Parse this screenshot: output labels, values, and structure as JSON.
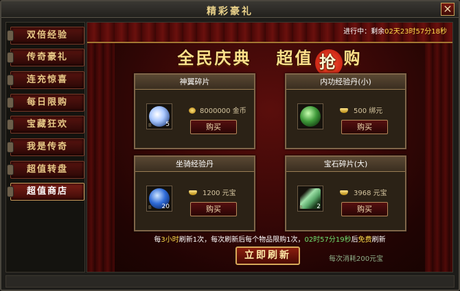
{
  "window": {
    "title": "精彩豪礼",
    "close_label": "×"
  },
  "sidebar": {
    "items": [
      {
        "label": "双倍经验"
      },
      {
        "label": "传奇豪礼"
      },
      {
        "label": "连充惊喜"
      },
      {
        "label": "每日限购"
      },
      {
        "label": "宝藏狂欢"
      },
      {
        "label": "我是传奇"
      },
      {
        "label": "超值转盘"
      },
      {
        "label": "超值商店",
        "active": true
      }
    ]
  },
  "status": {
    "prefix": "进行中：剩余",
    "remaining": "02天23时57分18秒"
  },
  "banner": {
    "part1": "全民庆典",
    "part2a": "超值",
    "part2b": "抢",
    "part2c": "购"
  },
  "cards": [
    {
      "name": "神翼碎片",
      "count": "5",
      "price": "8000000 金币",
      "currency_icon": "gold-coin-icon",
      "buy_label": "购买",
      "item_icon": "wing-icon",
      "art_color": "#aac8ff"
    },
    {
      "name": "内功经验丹(小)",
      "count": "",
      "price": "500 绑元",
      "currency_icon": "ingot-icon",
      "buy_label": "购买",
      "item_icon": "green-orb-icon",
      "art_color": "#3f9a3a"
    },
    {
      "name": "坐骑经验丹",
      "count": "20",
      "price": "1200 元宝",
      "currency_icon": "ingot-icon",
      "buy_label": "购买",
      "item_icon": "blue-orb-icon",
      "art_color": "#2f6bd8"
    },
    {
      "name": "宝石碎片(大)",
      "count": "2",
      "price": "3968 元宝",
      "currency_icon": "ingot-icon",
      "buy_label": "购买",
      "item_icon": "gem-shard-icon",
      "art_color": "#5aa86a"
    }
  ],
  "info": {
    "t1": "每",
    "t2": "3小时",
    "t3": "刷新1次，每次刷新后每个物品限购1次，",
    "t4": "02时57分19秒",
    "t5": "后",
    "t6": "免费",
    "t7": "刷新"
  },
  "refresh": {
    "label": "立即刷新",
    "cost": "每次消耗200元宝"
  }
}
